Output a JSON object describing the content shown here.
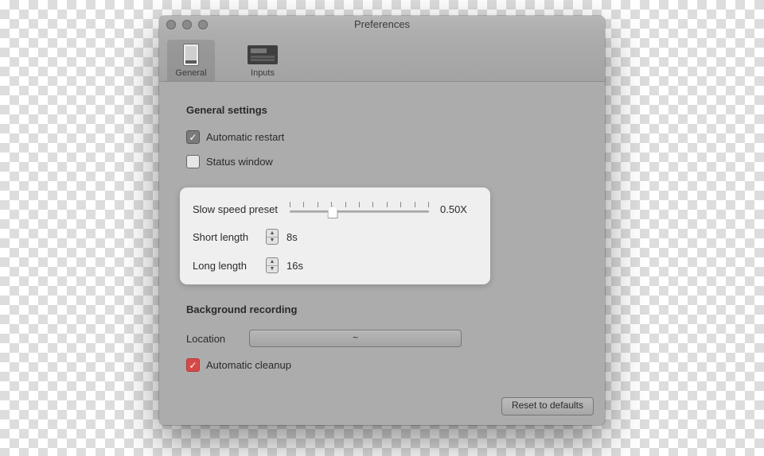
{
  "window": {
    "title": "Preferences"
  },
  "tabs": {
    "general": "General",
    "inputs": "Inputs"
  },
  "general": {
    "heading": "General settings",
    "auto_restart": "Automatic restart",
    "status_window": "Status window"
  },
  "speed": {
    "label": "Slow speed preset",
    "value": "0.50X",
    "short_label": "Short length",
    "short_value": "8s",
    "long_label": "Long length",
    "long_value": "16s"
  },
  "bg": {
    "heading": "Background recording",
    "location_label": "Location",
    "location_value": "~",
    "cleanup": "Automatic cleanup"
  },
  "reset": "Reset to defaults"
}
